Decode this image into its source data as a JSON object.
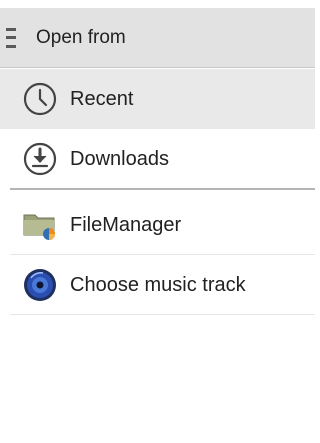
{
  "header": {
    "title": "Open from",
    "menu_icon": "hamburger-menu-icon"
  },
  "sources": [
    {
      "label": "Recent",
      "icon": "clock-icon"
    },
    {
      "label": "Downloads",
      "icon": "download-icon"
    }
  ],
  "apps": [
    {
      "label": "FileManager",
      "icon": "folder-icon"
    },
    {
      "label": "Choose music track",
      "icon": "music-disc-icon"
    }
  ],
  "colors": {
    "header_bg": "#e2e2e2",
    "selected_bg": "#e9e9e9",
    "accent_orange": "#f08a1c",
    "disc_blue": "#2b4fb0"
  }
}
